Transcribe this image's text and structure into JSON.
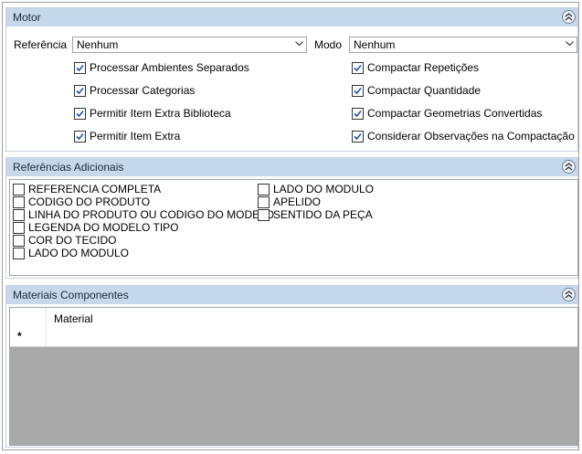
{
  "motor": {
    "title": "Motor",
    "referencia_label": "Referência",
    "referencia_value": "Nenhum",
    "modo_label": "Modo",
    "modo_value": "Nenhum",
    "left_options": [
      {
        "label": "Processar Ambientes Separados",
        "checked": true
      },
      {
        "label": "Processar Categorias",
        "checked": true
      },
      {
        "label": "Permitir Item Extra Biblioteca",
        "checked": true
      },
      {
        "label": "Permitir Item Extra",
        "checked": true
      }
    ],
    "right_options": [
      {
        "label": "Compactar Repetições",
        "checked": true
      },
      {
        "label": "Compactar Quantidade",
        "checked": true
      },
      {
        "label": "Compactar Geometrias Convertidas",
        "checked": true
      },
      {
        "label": "Considerar Observações na Compactação",
        "checked": true
      }
    ]
  },
  "referencias": {
    "title": "Referências Adicionais",
    "col1": [
      {
        "label": "REFERENCIA COMPLETA",
        "checked": false
      },
      {
        "label": "CODIGO DO PRODUTO",
        "checked": false
      },
      {
        "label": "LINHA DO PRODUTO OU CODIGO DO MODELO",
        "checked": false
      },
      {
        "label": "LEGENDA DO MODELO TIPO",
        "checked": false
      },
      {
        "label": "COR DO TECIDO",
        "checked": false
      },
      {
        "label": "LADO DO MODULO",
        "checked": false
      }
    ],
    "col2": [
      {
        "label": "LADO DO MODULO",
        "checked": false
      },
      {
        "label": "APELIDO",
        "checked": false
      },
      {
        "label": "SENTIDO DA PEÇA",
        "checked": false
      }
    ]
  },
  "materiais": {
    "title": "Materiais Componentes",
    "column_header": "Material",
    "new_row_marker": "*"
  },
  "colors": {
    "header_bg": "#c6d8ec",
    "grid_empty_bg": "#a9a9a9",
    "check_color": "#1a56b8"
  }
}
